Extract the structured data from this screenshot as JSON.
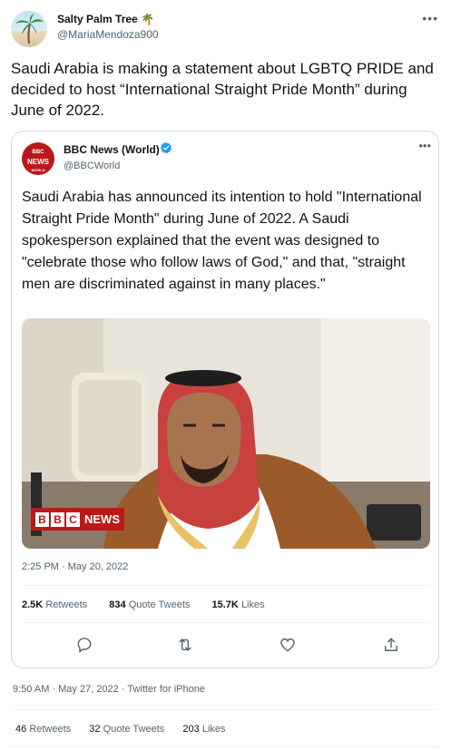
{
  "tweet": {
    "author_name": "Salty Palm Tree 🌴",
    "author_handle": "@MariaMendoza900",
    "more_icon": "more-icon",
    "text": "Saudi Arabia is making a statement about LGBTQ PRIDE and decided to host “International Straight Pride Month” during June of 2022.",
    "timestamp": "9:50 AM · May 27, 2022 · Twitter for iPhone",
    "retweets_count": "46",
    "retweets_label": "Retweets",
    "quote_tweets_count": "32",
    "quote_tweets_label": "Quote Tweets",
    "likes_count": "203",
    "likes_label": "Likes"
  },
  "quoted": {
    "logo": {
      "line1": "BBC",
      "line2": "NEWS",
      "line3": "WORLD"
    },
    "author_name": "BBC News (World)",
    "author_handle": "@BBCWorld",
    "verified_icon": "verified-badge-icon",
    "text": "Saudi Arabia has announced its intention to hold \"International Straight Pride Month\" during June of 2022. A Saudi spokesperson explained that the event was designed to \"celebrate those who follow laws of God,\" and that, \"straight men are discriminated against in many places.\"",
    "image_badge": {
      "letters": [
        "B",
        "B",
        "C"
      ],
      "word": "NEWS"
    },
    "timestamp": "2:25 PM · May 20, 2022",
    "retweets_count": "2.5K",
    "retweets_label": "Retweets",
    "quote_tweets_count": "834",
    "quote_tweets_label": "Quote Tweets",
    "likes_count": "15.7K",
    "likes_label": "Likes",
    "actions": [
      "reply-icon",
      "retweet-icon",
      "like-icon",
      "share-icon"
    ]
  },
  "colors": {
    "text_primary": "#0f1419",
    "text_secondary": "#536471",
    "border": "#cfd9de",
    "bbc_red": "#bb1919",
    "verified_blue": "#1d9bf0"
  }
}
